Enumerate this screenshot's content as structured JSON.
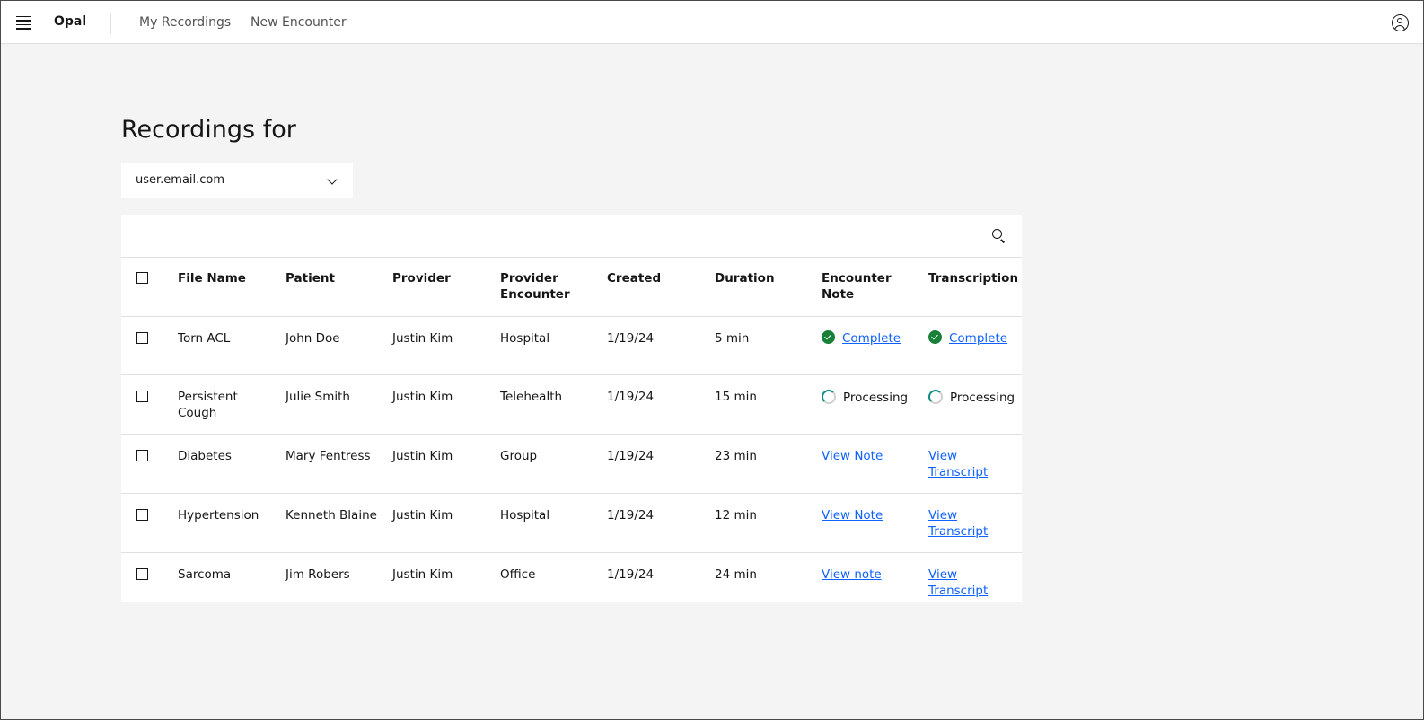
{
  "header": {
    "brand": "Opal",
    "nav": [
      "My Recordings",
      "New Encounter"
    ]
  },
  "page": {
    "title": "Recordings for",
    "user_select_value": "user.email.com"
  },
  "table": {
    "columns": [
      "File Name",
      "Patient",
      "Provider",
      "Provider Encounter",
      "Created",
      "Duration",
      "Encounter Note",
      "Transcription"
    ],
    "rows": [
      {
        "file_name": "Torn ACL",
        "patient": "John Doe",
        "provider": "Justin Kim",
        "encounter": "Hospital",
        "created": "1/19/24",
        "duration": "5 min",
        "note": {
          "type": "complete",
          "label": "Complete"
        },
        "transcription": {
          "type": "complete",
          "label": "Complete"
        }
      },
      {
        "file_name": "Persistent Cough",
        "patient": "Julie Smith",
        "provider": "Justin Kim",
        "encounter": "Telehealth",
        "created": "1/19/24",
        "duration": "15 min",
        "note": {
          "type": "processing",
          "label": "Processing"
        },
        "transcription": {
          "type": "processing",
          "label": "Processing"
        }
      },
      {
        "file_name": "Diabetes",
        "patient": "Mary Fentress",
        "provider": "Justin Kim",
        "encounter": "Group",
        "created": "1/19/24",
        "duration": "23 min",
        "note": {
          "type": "link",
          "label": "View Note"
        },
        "transcription": {
          "type": "link",
          "label": "View Transcript"
        }
      },
      {
        "file_name": "Hypertension",
        "patient": "Kenneth Blaine",
        "provider": "Justin Kim",
        "encounter": "Hospital",
        "created": "1/19/24",
        "duration": "12 min",
        "note": {
          "type": "link",
          "label": "View Note"
        },
        "transcription": {
          "type": "link",
          "label": "View Transcript"
        }
      },
      {
        "file_name": "Sarcoma",
        "patient": "Jim Robers",
        "provider": "Justin Kim",
        "encounter": "Office",
        "created": "1/19/24",
        "duration": "24 min",
        "note": {
          "type": "link",
          "label": "View note"
        },
        "transcription": {
          "type": "link",
          "label": "View Transcript"
        }
      }
    ]
  },
  "colors": {
    "link": "#0f62fe",
    "success": "#198038",
    "spinner": "#0e8a82",
    "page_bg": "#f4f4f4"
  },
  "icons": {
    "menu": "hamburger-menu-icon",
    "user": "user-avatar-icon",
    "search": "search-icon",
    "dropdown": "chevron-down-icon",
    "complete": "checkmark-filled-icon",
    "processing": "spinner-icon"
  }
}
